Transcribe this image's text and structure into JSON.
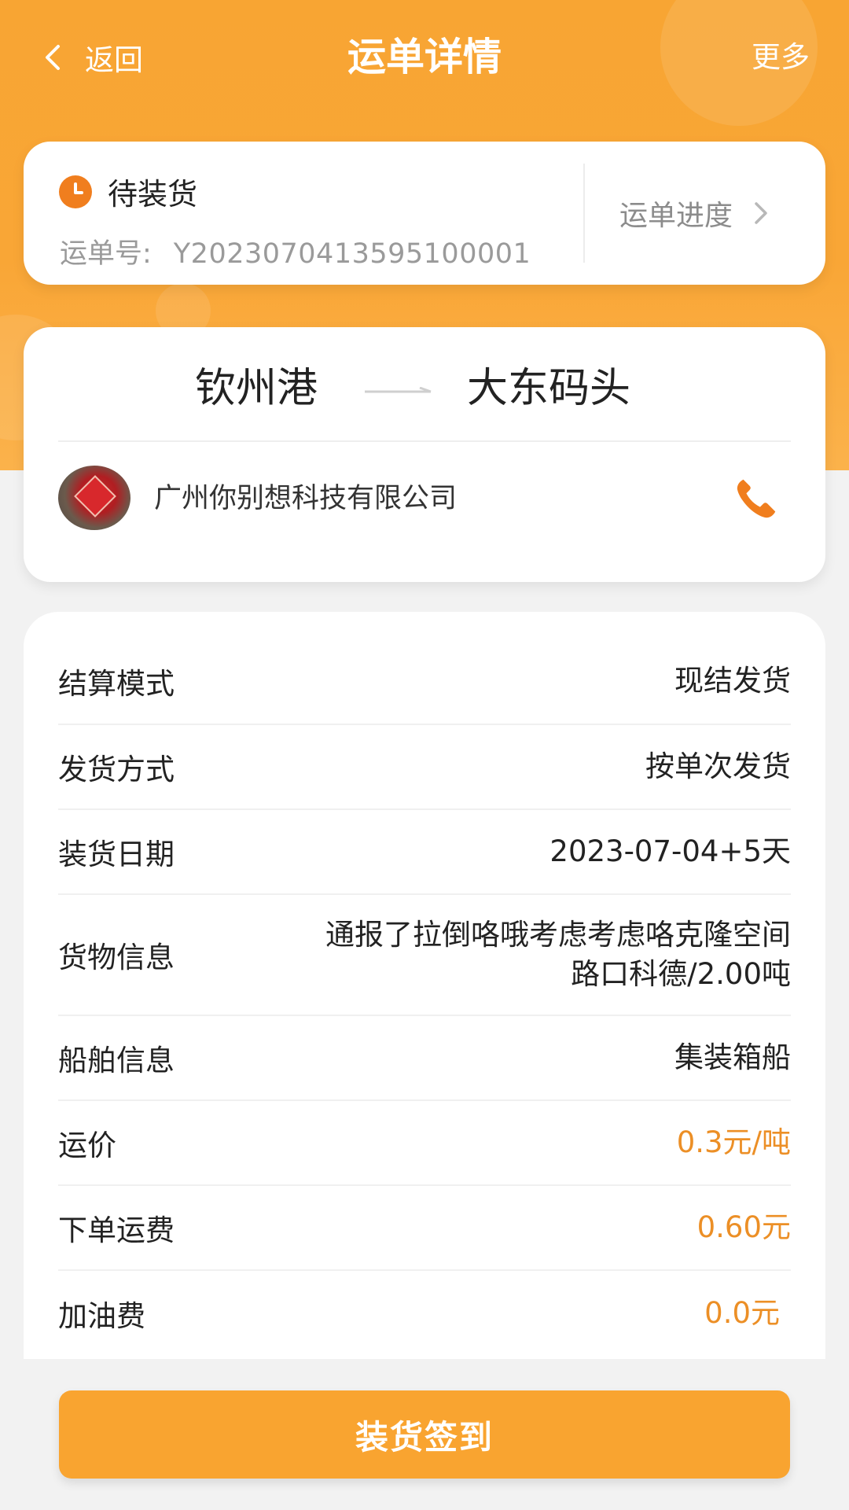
{
  "nav": {
    "back_label": "返回",
    "title": "运单详情",
    "more_label": "更多"
  },
  "status": {
    "state": "待装货",
    "waybill_label": "运单号:",
    "waybill_number": "Y2023070413595100001",
    "progress_link": "运单进度"
  },
  "route": {
    "from": "钦州港",
    "to": "大东码头"
  },
  "company": {
    "name": "广州你别想科技有限公司"
  },
  "details": [
    {
      "label": "结算模式",
      "value": "现结发货"
    },
    {
      "label": "发货方式",
      "value": "按单次发货"
    },
    {
      "label": "装货日期",
      "value": "2023-07-04+5天"
    },
    {
      "label": "货物信息",
      "value_line1": "通报了拉倒咯哦考虑考虑咯克隆空间",
      "value_line2": "路口科德/2.00吨"
    },
    {
      "label": "船舶信息",
      "value": "集装箱船"
    },
    {
      "label": "运价",
      "value": "0.3元/吨"
    },
    {
      "label": "下单运费",
      "value": "0.60元"
    },
    {
      "label": "加油费",
      "value": "0.0元"
    }
  ],
  "bottom_button": "装货签到",
  "colors": {
    "primary": "#f9a430",
    "accent_orange": "#ec8f26",
    "status_icon": "#f07e1e",
    "background": "#f2f2f2"
  },
  "icons": [
    "chevron-left-icon",
    "clock-icon",
    "chevron-right-icon",
    "arrow-right-icon",
    "phone-icon"
  ]
}
